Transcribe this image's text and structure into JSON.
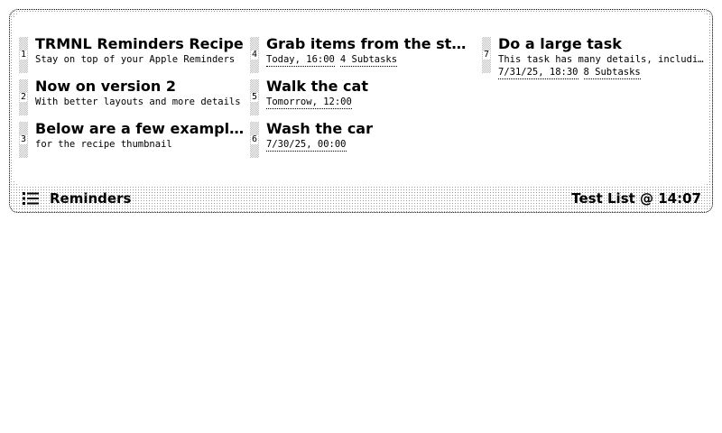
{
  "columns": [
    [
      {
        "number": "1",
        "title": "TRMNL Reminders Recipe",
        "notes": "Stay on top of your Apple Reminders",
        "tags": []
      },
      {
        "number": "2",
        "title": "Now on version 2",
        "notes": "With better layouts and more details",
        "tags": []
      },
      {
        "number": "3",
        "title": "Below are a few example tasks",
        "notes": "for the recipe thumbnail",
        "tags": []
      }
    ],
    [
      {
        "number": "4",
        "title": "Grab items from the store",
        "notes": "",
        "tags": [
          "Today, 16:00",
          "4 Subtasks"
        ]
      },
      {
        "number": "5",
        "title": "Walk the cat",
        "notes": "",
        "tags": [
          "Tomorrow, 12:00"
        ]
      },
      {
        "number": "6",
        "title": "Wash the car",
        "notes": "",
        "tags": [
          "7/30/25, 00:00"
        ]
      }
    ],
    [
      {
        "number": "7",
        "title": "Do a large task",
        "notes": "This task has many details, including",
        "tags": [
          "7/31/25, 18:30",
          "8 Subtasks"
        ]
      }
    ]
  ],
  "title_bar": {
    "icon": "list-icon",
    "label": "Reminders",
    "instance": "Test List @ 14:07"
  }
}
